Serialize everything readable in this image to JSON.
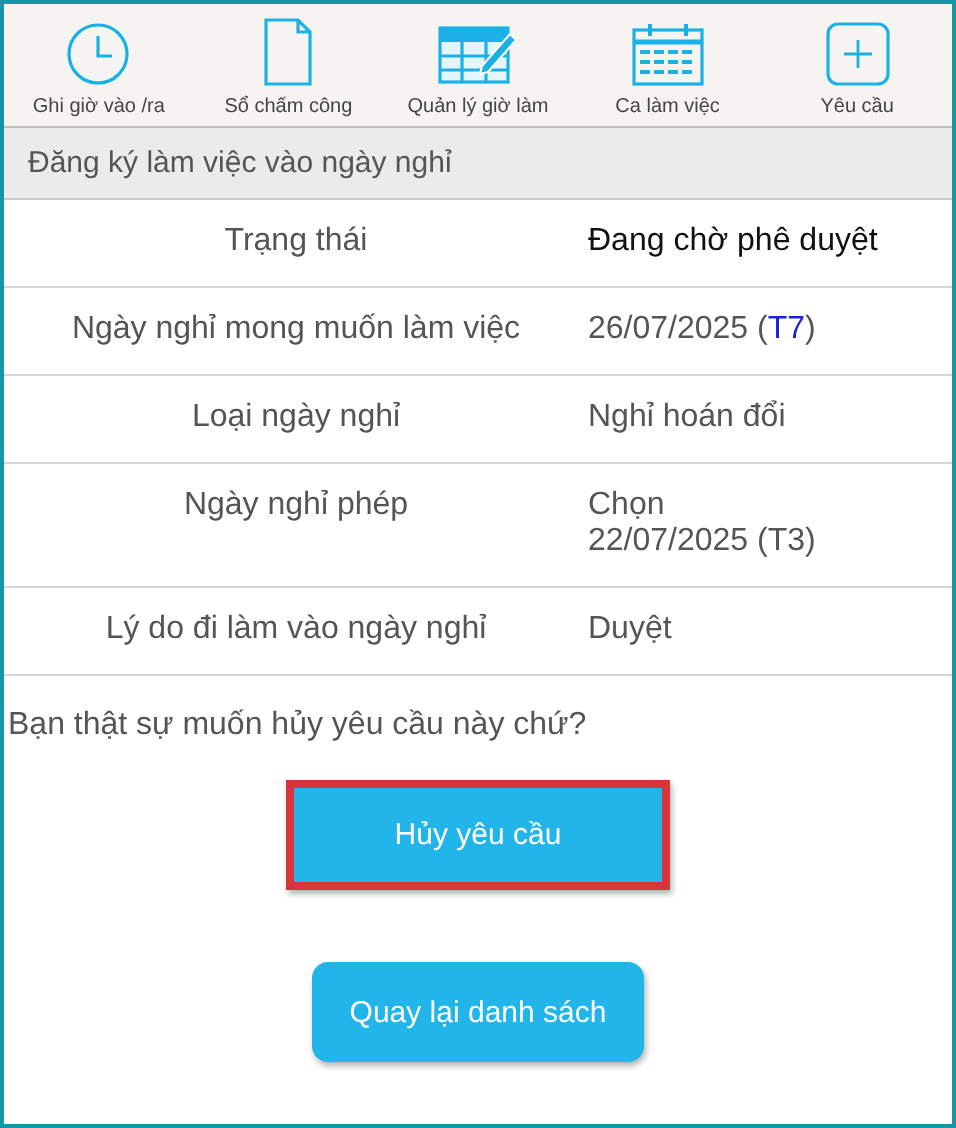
{
  "nav": [
    {
      "label": "Ghi giờ vào /ra"
    },
    {
      "label": "Sổ chấm công"
    },
    {
      "label": "Quản lý giờ làm"
    },
    {
      "label": "Ca làm việc"
    },
    {
      "label": "Yêu cầu"
    }
  ],
  "section_title": "Đăng ký làm việc vào ngày nghỉ",
  "rows": [
    {
      "label": "Trạng thái",
      "emphasis": true,
      "lines": [
        [
          {
            "text": "Đang chờ phê duyệt",
            "highlighted": false
          }
        ]
      ]
    },
    {
      "label": "Ngày nghỉ mong muốn làm việc",
      "emphasis": false,
      "lines": [
        [
          {
            "text": "26/07/2025 (",
            "highlighted": false
          },
          {
            "text": "T7",
            "highlighted": true
          },
          {
            "text": ")",
            "highlighted": false
          }
        ]
      ]
    },
    {
      "label": "Loại ngày nghỉ",
      "emphasis": false,
      "lines": [
        [
          {
            "text": "Nghỉ hoán đổi",
            "highlighted": false
          }
        ]
      ]
    },
    {
      "label": "Ngày nghỉ phép",
      "emphasis": false,
      "lines": [
        [
          {
            "text": "Chọn",
            "highlighted": false
          }
        ],
        [
          {
            "text": "22/07/2025 (T3)",
            "highlighted": false
          }
        ]
      ]
    },
    {
      "label": "Lý do đi làm vào ngày nghỉ",
      "emphasis": false,
      "lines": [
        [
          {
            "text": "Duyệt",
            "highlighted": false
          }
        ]
      ]
    }
  ],
  "question": "Bạn thật sự muốn hủy yêu cầu này chứ?",
  "cancel_button": {
    "label": "Hủy yêu cầu",
    "highlighted": true
  },
  "back_button": {
    "label": "Quay lại danh sách"
  }
}
